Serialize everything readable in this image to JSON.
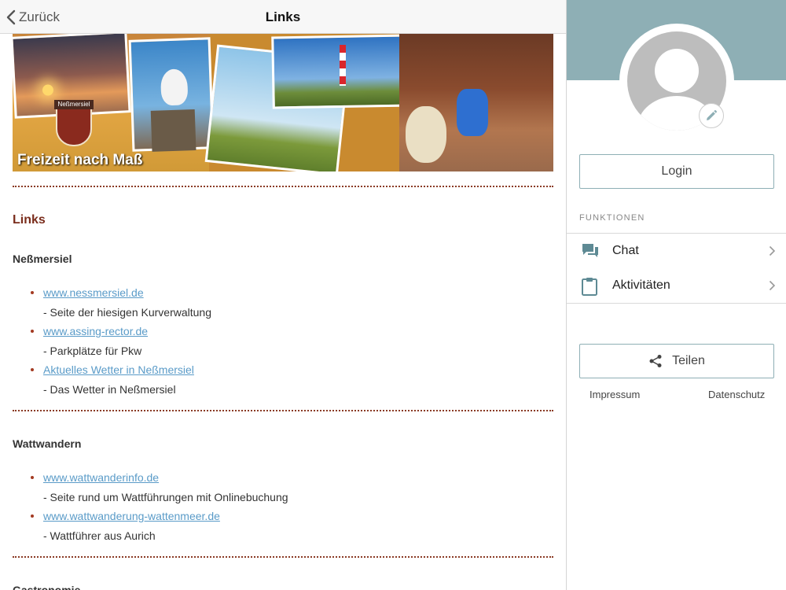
{
  "navbar": {
    "back_label": "Zurück",
    "title": "Links"
  },
  "banner": {
    "logo_text": "Neßmersiel",
    "tagline": "Freizeit nach Maß"
  },
  "page": {
    "heading": "Links"
  },
  "sections": [
    {
      "title": "Neßmersiel",
      "items": [
        {
          "link": "www.nessmersiel.de",
          "desc": "- Seite der hiesigen Kurverwaltung"
        },
        {
          "link": "www.assing-rector.de",
          "desc": "- Parkplätze für Pkw"
        },
        {
          "link": "Aktuelles Wetter in Neßmersiel",
          "desc": "- Das Wetter in Neßmersiel"
        }
      ]
    },
    {
      "title": "Wattwandern",
      "items": [
        {
          "link": "www.wattwanderinfo.de",
          "desc": "- Seite rund um Wattführungen mit Onlinebuchung"
        },
        {
          "link": "www.wattwanderung-wattenmeer.de",
          "desc": "- Wattführer aus Aurich"
        }
      ]
    },
    {
      "title": "Gastronomie",
      "items": []
    }
  ],
  "sidebar": {
    "login_label": "Login",
    "functions_label": "FUNKTIONEN",
    "menu": [
      {
        "label": "Chat",
        "icon": "chat-icon"
      },
      {
        "label": "Aktivitäten",
        "icon": "clipboard-icon"
      }
    ],
    "share_label": "Teilen",
    "footer": {
      "impressum": "Impressum",
      "datenschutz": "Datenschutz"
    },
    "colors": {
      "accent": "#8eafb5",
      "link": "#5a9bc8",
      "heading": "#7a2d1c"
    }
  }
}
